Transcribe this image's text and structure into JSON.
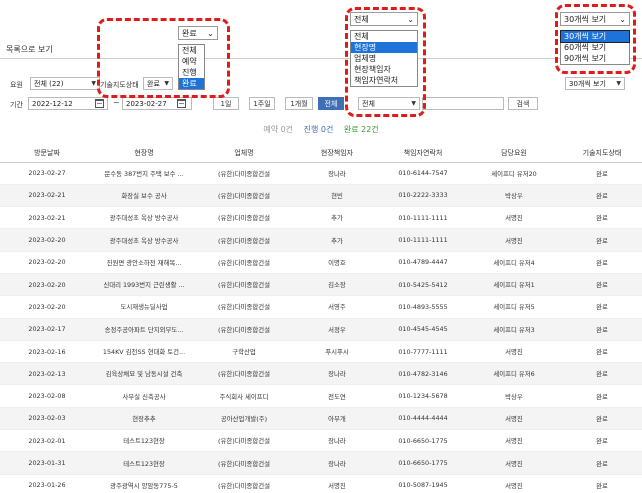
{
  "header": {
    "list_view_tab": "목록으로 보기"
  },
  "filters": {
    "agent_label": "요원",
    "agent_value": "전체 (22)",
    "status_label": "기술지도상태",
    "status_value": "완료",
    "date_label": "기간",
    "date_from": "2022-12-12",
    "date_to": "2023-02-27",
    "tilde": "~",
    "period_buttons": [
      "1일",
      "1주일",
      "1개월",
      "전체"
    ],
    "field_value": "전체",
    "search_button": "검색",
    "page_size_value": "30개씩 보기"
  },
  "summary": {
    "waiting": "예약 0건",
    "in_progress": "진행 0건",
    "done": "완료 22건"
  },
  "table": {
    "headers": [
      "방문날짜",
      "현장명",
      "업체명",
      "현장책임자",
      "책임자연락처",
      "담당요원",
      "기술지도상태"
    ],
    "rows": [
      [
        "2023-02-27",
        "문수동 387번지 주택 보수 ...",
        "(유한)다미종합건설",
        "장나라",
        "010-6144-7547",
        "세이프디 유저20",
        "완료"
      ],
      [
        "2023-02-21",
        "화장실 보수 공사",
        "(유한)다미종합건설",
        "현빈",
        "010-2222-3333",
        "박상우",
        "완료"
      ],
      [
        "2023-02-21",
        "광주대성초 옥상 방수공사",
        "(유한)다미종합건설",
        "추가",
        "010-1111-1111",
        "서명진",
        "완료"
      ],
      [
        "2023-02-20",
        "광주대성초 옥상 방수공사",
        "(유한)다미종합건설",
        "추가",
        "010-1111-1111",
        "서명진",
        "완료"
      ],
      [
        "2023-02-20",
        "진원면 광안소하천 재해복...",
        "(유한)다미종합건설",
        "이명호",
        "010-4789-4447",
        "세이프디 유저4",
        "완료"
      ],
      [
        "2023-02-20",
        "신대리 1993번지 근린생활 ...",
        "(유한)다미종합건설",
        "김소장",
        "010-5425-5412",
        "세이프디 유저1",
        "완료"
      ],
      [
        "2023-02-20",
        "도시재생뉴딜사업",
        "(유한)다미종합건설",
        "서영주",
        "010-4893-5555",
        "세이프디 유저5",
        "완료"
      ],
      [
        "2023-02-17",
        "송정주공아파트 단지외부도...",
        "(유한)다미종합건설",
        "서정우",
        "010-4545-4545",
        "세이프디 유저3",
        "완료"
      ],
      [
        "2023-02-16",
        "154KV 김천SS 현대화 토건...",
        "구학산업",
        "푸시푸시",
        "010-7777-1111",
        "서명진",
        "완료"
      ],
      [
        "2023-02-13",
        "김육상채묘 및 남동시설 건축",
        "(유한)다미종합건설",
        "장나라",
        "010-4782-3146",
        "세이프디 유저6",
        "완료"
      ],
      [
        "2023-02-08",
        "사무실 신축공사",
        "주식회사 세이프디",
        "전도연",
        "010-1234-5678",
        "박상우",
        "완료"
      ],
      [
        "2023-02-03",
        "현장추추",
        "공아산업개발(주)",
        "아무개",
        "010-4444-4444",
        "서명진",
        "완료"
      ],
      [
        "2023-02-01",
        "테스트123현장",
        "(유한)다미종합건설",
        "장나라",
        "010-6650-1775",
        "서명진",
        "완료"
      ],
      [
        "2023-01-31",
        "테스트123현장",
        "(유한)다미종합건설",
        "장나라",
        "010-6650-1775",
        "서명진",
        "완료"
      ],
      [
        "2023-01-26",
        "광주광역시 양암동775-5",
        "(유한)다미종합건설",
        "서명진",
        "010-5087-1945",
        "서명진",
        "완료"
      ]
    ]
  },
  "dropdown_status": {
    "selected": "완료",
    "options": [
      "전체",
      "예약",
      "진행",
      "완료"
    ],
    "highlighted_index": 3
  },
  "dropdown_field": {
    "selected": "전체",
    "options": [
      "전체",
      "현장명",
      "업체명",
      "현장책임자",
      "책임자연락처"
    ],
    "highlighted_index": 1
  },
  "dropdown_pagesize": {
    "selected": "30개씩 보기",
    "options": [
      "30개씩 보기",
      "60개씩 보기",
      "90개씩 보기"
    ],
    "highlighted_index": 0
  },
  "colors": {
    "accent": "#3f6fb5",
    "highlight": "#1e73d9",
    "callout": "#e01b1b",
    "done": "#3a9a3a"
  }
}
